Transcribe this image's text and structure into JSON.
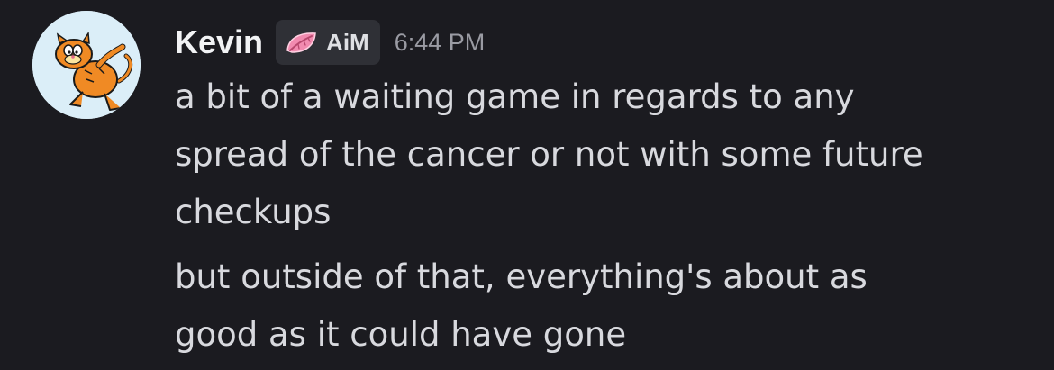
{
  "message": {
    "author": "Kevin",
    "tag": {
      "label": "AiM",
      "icon": "pink-leaf-icon"
    },
    "timestamp": "6:44 PM",
    "avatar": "garfield-avatar",
    "paragraphs": [
      [
        "a bit of a waiting game in regards to any",
        "spread of the cancer or not with some future",
        "checkups"
      ],
      [
        "but outside of that, everything's about as",
        "good as it could have gone"
      ]
    ]
  },
  "colors": {
    "background": "#1b1b20",
    "username": "#f2f3f5",
    "message_text": "#d8d9de",
    "timestamp": "#9a9ba3",
    "tag_background": "#2f3036",
    "tag_icon": "#f28bb0"
  }
}
